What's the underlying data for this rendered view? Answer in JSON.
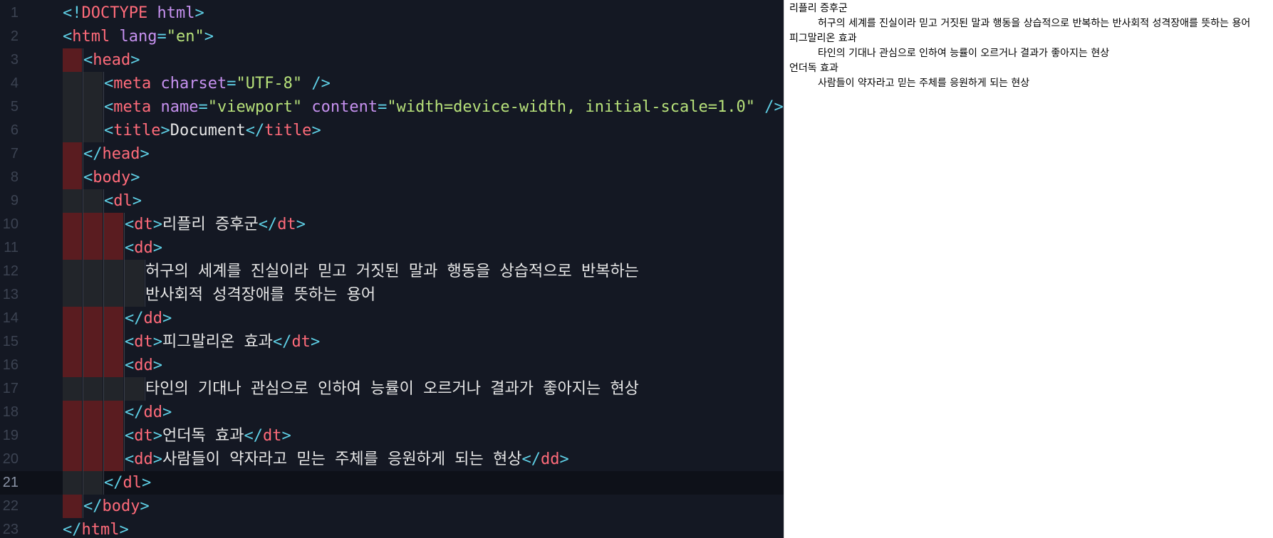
{
  "editor": {
    "active_line": 21,
    "lines": [
      {
        "n": "1",
        "indent": 0,
        "guides": [],
        "tokens": [
          {
            "t": "<!",
            "c": "punc"
          },
          {
            "t": "DOCTYPE",
            "c": "doct"
          },
          {
            "t": " html",
            "c": "attr"
          },
          {
            "t": ">",
            "c": "punc"
          }
        ]
      },
      {
        "n": "2",
        "indent": 0,
        "guides": [],
        "tokens": [
          {
            "t": "<",
            "c": "punc"
          },
          {
            "t": "html",
            "c": "tag"
          },
          {
            "t": " lang",
            "c": "attr"
          },
          {
            "t": "=",
            "c": "eq"
          },
          {
            "t": "\"en\"",
            "c": "str"
          },
          {
            "t": ">",
            "c": "punc"
          }
        ]
      },
      {
        "n": "3",
        "indent": 1,
        "guides": [
          "red"
        ],
        "tokens": [
          {
            "t": "<",
            "c": "punc"
          },
          {
            "t": "head",
            "c": "tag"
          },
          {
            "t": ">",
            "c": "punc"
          }
        ]
      },
      {
        "n": "4",
        "indent": 2,
        "guides": [
          "dark",
          "dark"
        ],
        "tokens": [
          {
            "t": "<",
            "c": "punc"
          },
          {
            "t": "meta",
            "c": "tag"
          },
          {
            "t": " charset",
            "c": "attr"
          },
          {
            "t": "=",
            "c": "eq"
          },
          {
            "t": "\"UTF-8\"",
            "c": "str"
          },
          {
            "t": " />",
            "c": "punc"
          }
        ]
      },
      {
        "n": "5",
        "indent": 2,
        "guides": [
          "dark",
          "dark"
        ],
        "tokens": [
          {
            "t": "<",
            "c": "punc"
          },
          {
            "t": "meta",
            "c": "tag"
          },
          {
            "t": " name",
            "c": "attr"
          },
          {
            "t": "=",
            "c": "eq"
          },
          {
            "t": "\"viewport\"",
            "c": "str"
          },
          {
            "t": " content",
            "c": "attr"
          },
          {
            "t": "=",
            "c": "eq"
          },
          {
            "t": "\"width=device-width, initial-scale=1.0\"",
            "c": "str"
          },
          {
            "t": " />",
            "c": "punc"
          }
        ]
      },
      {
        "n": "6",
        "indent": 2,
        "guides": [
          "dark",
          "dark"
        ],
        "tokens": [
          {
            "t": "<",
            "c": "punc"
          },
          {
            "t": "title",
            "c": "tag"
          },
          {
            "t": ">",
            "c": "punc"
          },
          {
            "t": "Document",
            "c": "text"
          },
          {
            "t": "</",
            "c": "punc"
          },
          {
            "t": "title",
            "c": "tag"
          },
          {
            "t": ">",
            "c": "punc"
          }
        ]
      },
      {
        "n": "7",
        "indent": 1,
        "guides": [
          "red"
        ],
        "tokens": [
          {
            "t": "</",
            "c": "punc"
          },
          {
            "t": "head",
            "c": "tag"
          },
          {
            "t": ">",
            "c": "punc"
          }
        ]
      },
      {
        "n": "8",
        "indent": 1,
        "guides": [
          "red"
        ],
        "tokens": [
          {
            "t": "<",
            "c": "punc"
          },
          {
            "t": "body",
            "c": "tag"
          },
          {
            "t": ">",
            "c": "punc"
          }
        ]
      },
      {
        "n": "9",
        "indent": 2,
        "guides": [
          "dark",
          "dark"
        ],
        "tokens": [
          {
            "t": "<",
            "c": "punc"
          },
          {
            "t": "dl",
            "c": "tag"
          },
          {
            "t": ">",
            "c": "punc"
          }
        ]
      },
      {
        "n": "10",
        "indent": 3,
        "guides": [
          "red",
          "red",
          "red"
        ],
        "tokens": [
          {
            "t": "<",
            "c": "punc"
          },
          {
            "t": "dt",
            "c": "tag"
          },
          {
            "t": ">",
            "c": "punc"
          },
          {
            "t": "리플리 증후군",
            "c": "text"
          },
          {
            "t": "</",
            "c": "punc"
          },
          {
            "t": "dt",
            "c": "tag"
          },
          {
            "t": ">",
            "c": "punc"
          }
        ]
      },
      {
        "n": "11",
        "indent": 3,
        "guides": [
          "red",
          "red",
          "red"
        ],
        "tokens": [
          {
            "t": "<",
            "c": "punc"
          },
          {
            "t": "dd",
            "c": "tag"
          },
          {
            "t": ">",
            "c": "punc"
          }
        ]
      },
      {
        "n": "12",
        "indent": 4,
        "guides": [
          "dark",
          "dark",
          "dark",
          "dark"
        ],
        "tokens": [
          {
            "t": "허구의 세계를 진실이라 믿고 거짓된 말과 행동을 상습적으로 반복하는",
            "c": "text"
          }
        ]
      },
      {
        "n": "13",
        "indent": 4,
        "guides": [
          "dark",
          "dark",
          "dark",
          "dark"
        ],
        "tokens": [
          {
            "t": "반사회적 성격장애를 뜻하는 용어",
            "c": "text"
          }
        ]
      },
      {
        "n": "14",
        "indent": 3,
        "guides": [
          "red",
          "red",
          "red"
        ],
        "tokens": [
          {
            "t": "</",
            "c": "punc"
          },
          {
            "t": "dd",
            "c": "tag"
          },
          {
            "t": ">",
            "c": "punc"
          }
        ]
      },
      {
        "n": "15",
        "indent": 3,
        "guides": [
          "red",
          "red",
          "red"
        ],
        "tokens": [
          {
            "t": "<",
            "c": "punc"
          },
          {
            "t": "dt",
            "c": "tag"
          },
          {
            "t": ">",
            "c": "punc"
          },
          {
            "t": "피그말리온 효과",
            "c": "text"
          },
          {
            "t": "</",
            "c": "punc"
          },
          {
            "t": "dt",
            "c": "tag"
          },
          {
            "t": ">",
            "c": "punc"
          }
        ]
      },
      {
        "n": "16",
        "indent": 3,
        "guides": [
          "red",
          "red",
          "red"
        ],
        "tokens": [
          {
            "t": "<",
            "c": "punc"
          },
          {
            "t": "dd",
            "c": "tag"
          },
          {
            "t": ">",
            "c": "punc"
          }
        ]
      },
      {
        "n": "17",
        "indent": 4,
        "guides": [
          "dark",
          "dark",
          "dark",
          "dark"
        ],
        "tokens": [
          {
            "t": "타인의 기대나 관심으로 인하여 능률이 오르거나 결과가 좋아지는 현상",
            "c": "text"
          }
        ]
      },
      {
        "n": "18",
        "indent": 3,
        "guides": [
          "red",
          "red",
          "red"
        ],
        "tokens": [
          {
            "t": "</",
            "c": "punc"
          },
          {
            "t": "dd",
            "c": "tag"
          },
          {
            "t": ">",
            "c": "punc"
          }
        ]
      },
      {
        "n": "19",
        "indent": 3,
        "guides": [
          "red",
          "red",
          "red"
        ],
        "tokens": [
          {
            "t": "<",
            "c": "punc"
          },
          {
            "t": "dt",
            "c": "tag"
          },
          {
            "t": ">",
            "c": "punc"
          },
          {
            "t": "언더독 효과",
            "c": "text"
          },
          {
            "t": "</",
            "c": "punc"
          },
          {
            "t": "dt",
            "c": "tag"
          },
          {
            "t": ">",
            "c": "punc"
          }
        ]
      },
      {
        "n": "20",
        "indent": 3,
        "guides": [
          "red",
          "red",
          "red"
        ],
        "tokens": [
          {
            "t": "<",
            "c": "punc"
          },
          {
            "t": "dd",
            "c": "tag"
          },
          {
            "t": ">",
            "c": "punc"
          },
          {
            "t": "사람들이 약자라고 믿는 주체를 응원하게 되는 현상",
            "c": "text"
          },
          {
            "t": "</",
            "c": "punc"
          },
          {
            "t": "dd",
            "c": "tag"
          },
          {
            "t": ">",
            "c": "punc"
          }
        ]
      },
      {
        "n": "21",
        "indent": 2,
        "guides": [
          "dark",
          "dark"
        ],
        "tokens": [
          {
            "t": "</",
            "c": "punc"
          },
          {
            "t": "dl",
            "c": "tag"
          },
          {
            "t": ">",
            "c": "punc"
          }
        ]
      },
      {
        "n": "22",
        "indent": 1,
        "guides": [
          "red"
        ],
        "tokens": [
          {
            "t": "</",
            "c": "punc"
          },
          {
            "t": "body",
            "c": "tag"
          },
          {
            "t": ">",
            "c": "punc"
          }
        ]
      },
      {
        "n": "23",
        "indent": 0,
        "guides": [],
        "tokens": [
          {
            "t": "</",
            "c": "punc"
          },
          {
            "t": "html",
            "c": "tag"
          },
          {
            "t": ">",
            "c": "punc"
          }
        ]
      }
    ]
  },
  "preview": {
    "items": [
      {
        "term": "리플리 증후군",
        "desc": "허구의 세계를 진실이라 믿고 거짓된 말과 행동을 상습적으로 반복하는 반사회적 성격장애를 뜻하는 용어"
      },
      {
        "term": "피그말리온 효과",
        "desc": "타인의 기대나 관심으로 인하여 능률이 오르거나 결과가 좋아지는 현상"
      },
      {
        "term": "언더독 효과",
        "desc": "사람들이 약자라고 믿는 주체를 응원하게 되는 현상"
      }
    ]
  },
  "colors": {
    "editor_bg": "#141823",
    "tag": "#ff6b7a",
    "punctuation": "#5fd0e6",
    "attribute": "#c691ef",
    "string": "#b7e17a",
    "text": "#e6e6e6",
    "guide_red": "#5a1c20",
    "guide_dark": "#22252a"
  }
}
